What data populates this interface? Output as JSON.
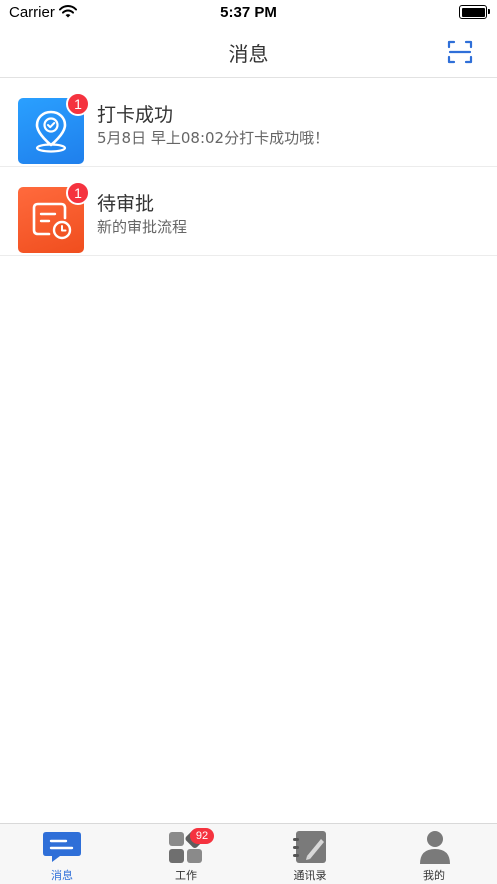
{
  "status_bar": {
    "carrier": "Carrier",
    "time": "5:37 PM"
  },
  "nav": {
    "title": "消息",
    "scan_icon": "scan-icon"
  },
  "messages": [
    {
      "title": "打卡成功",
      "subtitle": "5月8日 早上08:02分打卡成功哦！",
      "badge": "1",
      "icon": "location-check-icon",
      "color": "#2d8cf0"
    },
    {
      "title": "待审批",
      "subtitle": "新的审批流程",
      "badge": "1",
      "icon": "approval-clock-icon",
      "color": "#f25424"
    }
  ],
  "tabs": [
    {
      "label": "消息",
      "icon": "message-icon",
      "active": true
    },
    {
      "label": "工作",
      "icon": "grid-apps-icon",
      "badge": "92"
    },
    {
      "label": "通讯录",
      "icon": "contacts-book-icon"
    },
    {
      "label": "我的",
      "icon": "person-icon"
    }
  ],
  "colors": {
    "accent": "#2f6fd8",
    "badge": "#f5333f"
  }
}
